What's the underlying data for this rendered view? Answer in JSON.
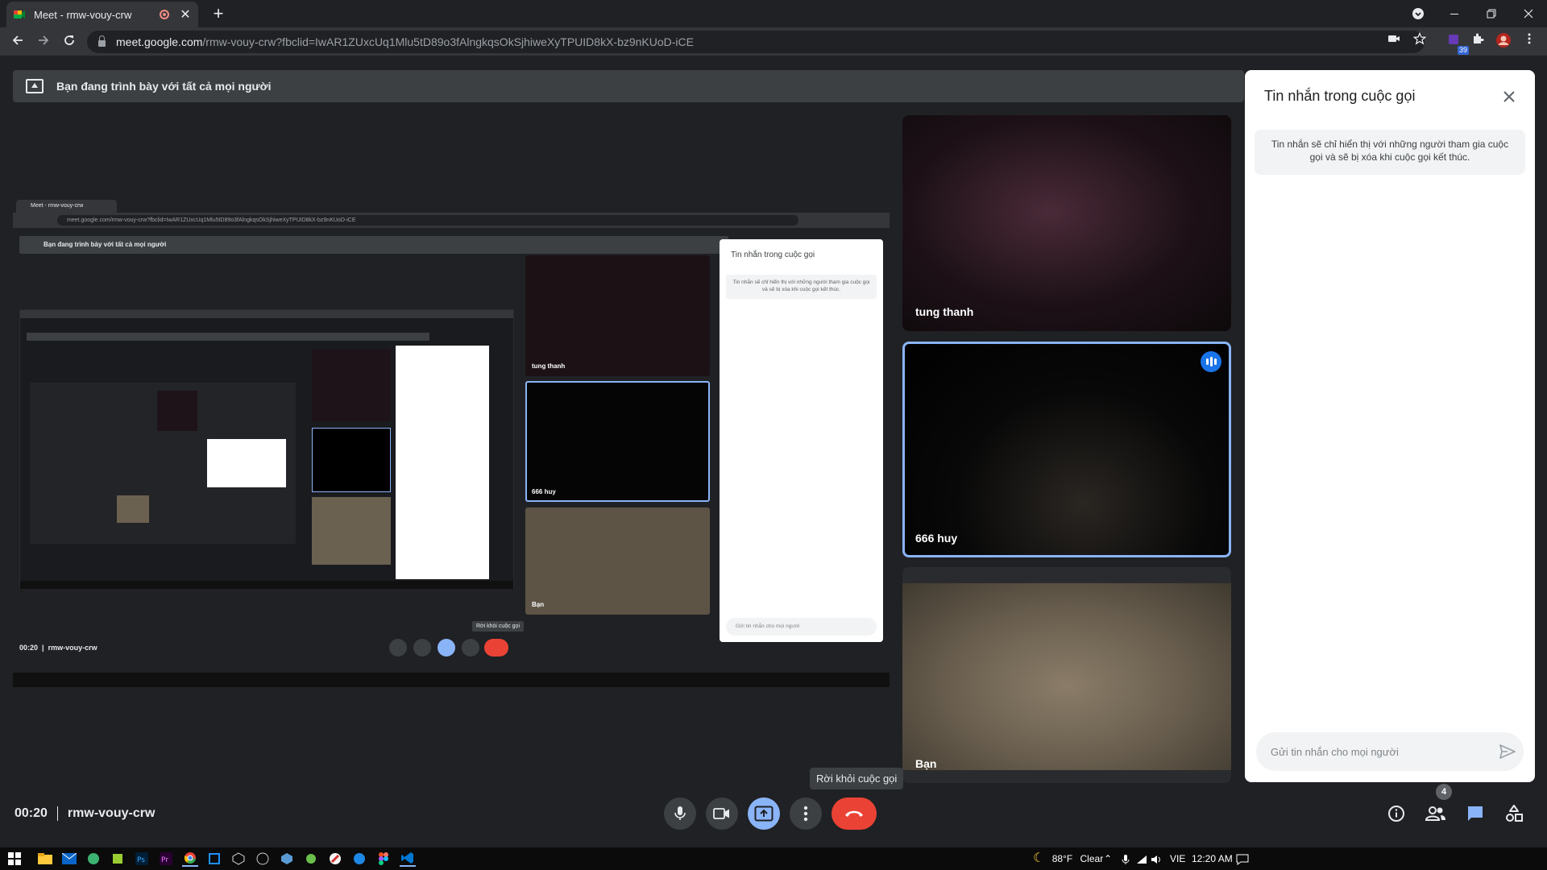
{
  "browser": {
    "tab_title": "Meet - rmw-vouy-crw",
    "url_host": "meet.google.com",
    "url_path": "/rmw-vouy-crw?fbclid=IwAR1ZUxcUq1Mlu5tD89o3fAlngkqsOkSjhiweXyTPUID8kX-bz9nKUoD-iCE",
    "extension_badge": "39"
  },
  "banner": {
    "text": "Bạn đang trình bày với tất cả mọi người"
  },
  "presentation": {
    "tab_title": "Meet - rmw-vouy-crw",
    "url": "meet.google.com/rmw-vouy-crw?fbclid=IwAR1ZUxcUq1Mlu5tD89o3fAlngkqsOkSjhiweXyTPUID8kX-bz9nKUoD-iCE",
    "banner": "Bạn đang trình bày với tất cả mọi người",
    "tile1": "tung thanh",
    "tile2": "666 huy",
    "tile3": "Bạn",
    "chat_title": "Tin nhắn trong cuộc gọi",
    "chat_note": "Tin nhắn sẽ chỉ hiển thị với những người tham gia cuộc gọi và sẽ bị xóa khi cuộc gọi kết thúc.",
    "chat_input": "Gửi tin nhắn cho mọi người",
    "time": "00:20",
    "code": "rmw-vouy-crw",
    "tooltip": "Rời khỏi cuộc gọi"
  },
  "participants": [
    {
      "name": "tung thanh"
    },
    {
      "name": "666 huy"
    },
    {
      "name": "Bạn"
    }
  ],
  "chat": {
    "title": "Tin nhắn trong cuộc gọi",
    "note": "Tin nhắn sẽ chỉ hiển thị với những người tham gia cuộc gọi và sẽ bị xóa khi cuộc gọi kết thúc.",
    "input_placeholder": "Gửi tin nhắn cho mọi người"
  },
  "controls": {
    "time": "00:20",
    "meeting_code": "rmw-vouy-crw",
    "leave_tooltip": "Rời khỏi cuộc gọi",
    "participant_count": "4"
  },
  "taskbar": {
    "temperature": "88°F",
    "weather": "Clear",
    "language": "VIE",
    "clock": "12:20 AM"
  },
  "colors": {
    "accent": "#8ab4f8",
    "leave": "#ea4335",
    "speaking": "#1a73e8"
  }
}
